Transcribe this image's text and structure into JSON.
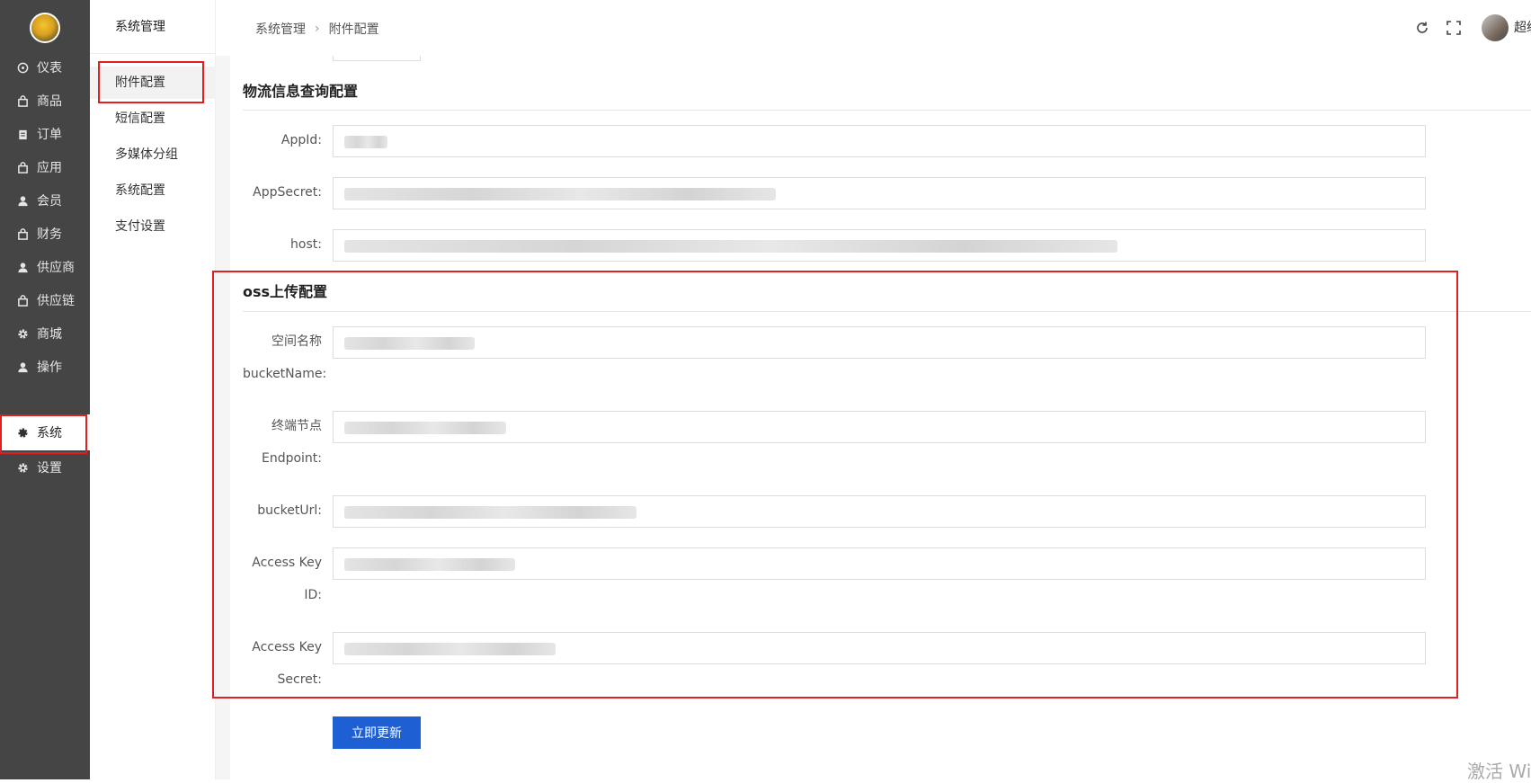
{
  "nav": {
    "items": [
      {
        "label": "仪表",
        "icon": "dashboard-icon"
      },
      {
        "label": "商品",
        "icon": "bag-icon"
      },
      {
        "label": "订单",
        "icon": "clipboard-icon"
      },
      {
        "label": "应用",
        "icon": "bag-icon"
      },
      {
        "label": "会员",
        "icon": "user-icon"
      },
      {
        "label": "财务",
        "icon": "bag-icon"
      },
      {
        "label": "供应商",
        "icon": "user-icon"
      },
      {
        "label": "供应链",
        "icon": "bag-icon"
      },
      {
        "label": "商城",
        "icon": "gear-icon"
      },
      {
        "label": "操作",
        "icon": "user-icon"
      },
      {
        "label": "系统",
        "icon": "gear-icon",
        "active": true
      },
      {
        "label": "设置",
        "icon": "gear-icon"
      }
    ]
  },
  "sidebar": {
    "title": "系统管理",
    "items": [
      {
        "label": "附件配置",
        "active": true
      },
      {
        "label": "短信配置"
      },
      {
        "label": "多媒体分组"
      },
      {
        "label": "系统配置"
      },
      {
        "label": "支付设置"
      }
    ]
  },
  "topbar": {
    "breadcrumb": [
      "系统管理",
      "附件配置"
    ],
    "user_name": "超级"
  },
  "sections": {
    "logistics_title": "物流信息查询配置",
    "oss_title": "oss上传配置"
  },
  "logistics_fields": [
    {
      "label": "AppId:"
    },
    {
      "label": "AppSecret:"
    },
    {
      "label": "host:"
    }
  ],
  "oss_fields": [
    {
      "label_line1": "空间名称",
      "label_line2": "bucketName:"
    },
    {
      "label_line1": "终端节点",
      "label_line2": "Endpoint:"
    },
    {
      "label_line1": "bucketUrl:",
      "label_line2": ""
    },
    {
      "label_line1": "Access Key",
      "label_line2": "ID:"
    },
    {
      "label_line1": "Access Key",
      "label_line2": "Secret:"
    }
  ],
  "submit_label": "立即更新",
  "watermark": "激活 Wi",
  "colors": {
    "nav_bg": "#454545",
    "primary_button": "#1e5fd4",
    "highlight_box": "#e02020"
  }
}
